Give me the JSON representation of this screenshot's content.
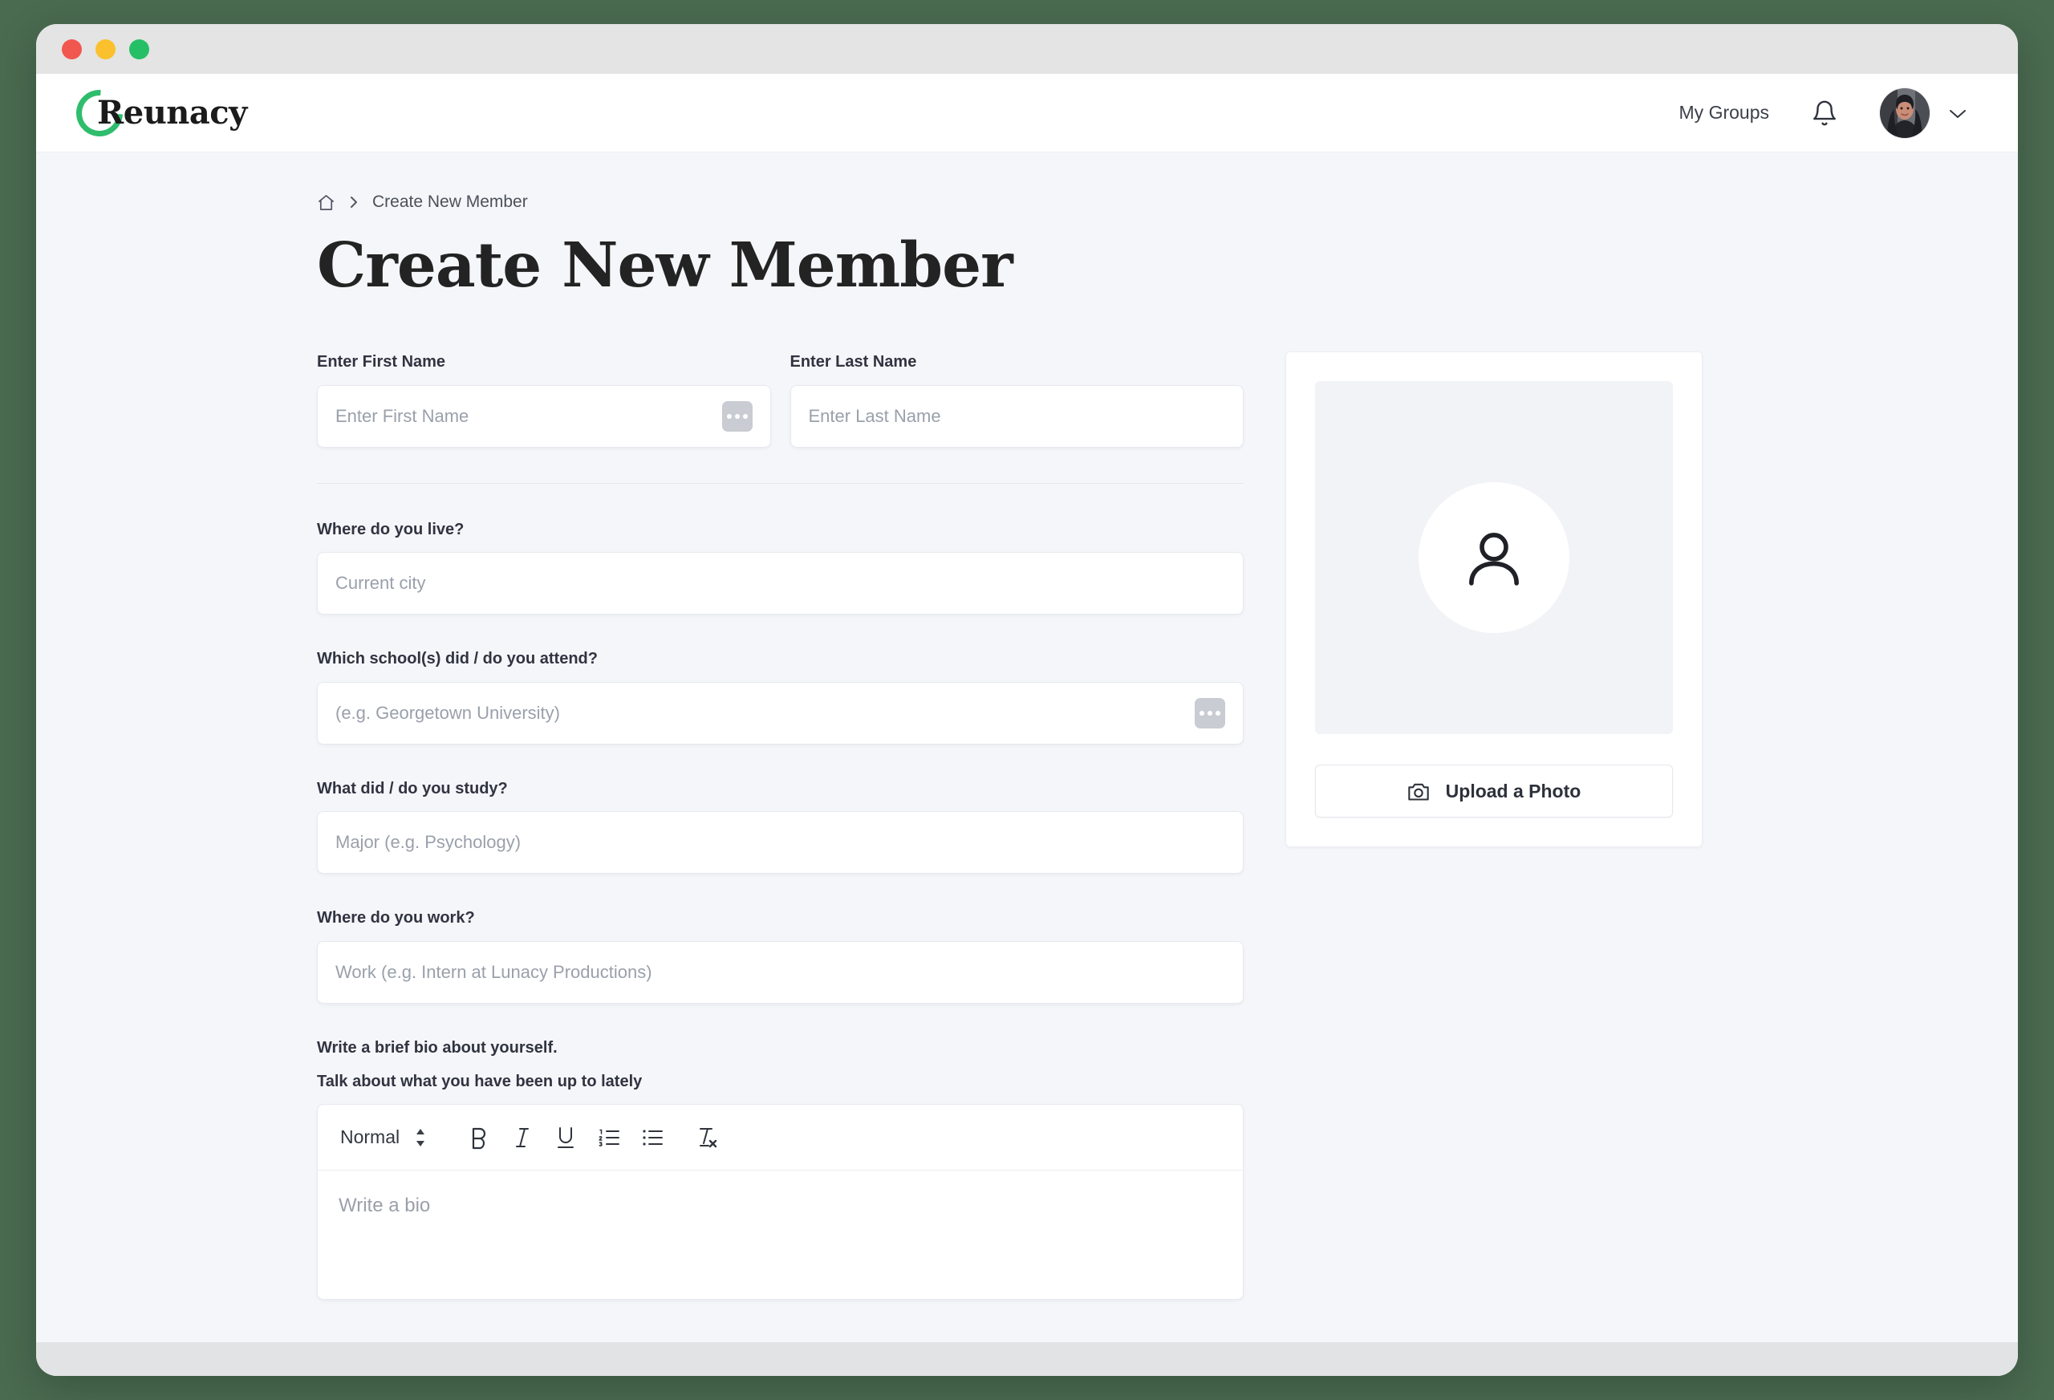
{
  "window": {
    "traffic_lights": [
      "close",
      "minimize",
      "maximize"
    ],
    "colors": {
      "desktop_background": "#4a6b50",
      "titlebar": "#e4e4e4",
      "page_background": "#f5f6fa",
      "brand_green": "#2fbd6d",
      "dot_red": "#f1574f",
      "dot_yellow": "#fbc02d",
      "dot_green": "#25c065"
    }
  },
  "header": {
    "logo_text": "Reunacy",
    "logo_icon": "green-ring-icon",
    "nav_link": "My Groups",
    "bell_icon": "bell-icon",
    "avatar_icon": "user-avatar-photo",
    "chevron_icon": "chevron-down-icon"
  },
  "breadcrumb": {
    "home_icon": "home-icon",
    "separator_icon": "chevron-right-icon",
    "current": "Create New Member"
  },
  "page": {
    "title": "Create New Member"
  },
  "form": {
    "first_name": {
      "label": "Enter First Name",
      "placeholder": "Enter First Name",
      "value": "",
      "chip_icon": "ellipsis-icon"
    },
    "last_name": {
      "label": "Enter Last Name",
      "placeholder": "Enter Last Name",
      "value": ""
    },
    "city": {
      "label": "Where do you live?",
      "placeholder": "Current city",
      "value": ""
    },
    "school": {
      "label": "Which school(s) did / do you attend?",
      "placeholder": "(e.g. Georgetown University)",
      "value": "",
      "chip_icon": "ellipsis-icon"
    },
    "study": {
      "label": "What did / do you study?",
      "placeholder": "Major (e.g. Psychology)",
      "value": ""
    },
    "work": {
      "label": "Where do you work?",
      "placeholder": "Work (e.g. Intern at Lunacy Productions)",
      "value": ""
    },
    "bio": {
      "label_line1": "Write a brief bio about yourself.",
      "label_line2": "Talk about what you have been up to lately",
      "placeholder": "Write a bio",
      "value": "",
      "toolbar": {
        "format_select": "Normal",
        "stepper_icon": "up-down-arrows-icon",
        "buttons": [
          {
            "name": "bold",
            "glyph": "B"
          },
          {
            "name": "italic",
            "glyph": "I"
          },
          {
            "name": "underline",
            "glyph": "U"
          },
          {
            "name": "ordered-list",
            "glyph": "1."
          },
          {
            "name": "bullet-list",
            "glyph": "•"
          },
          {
            "name": "clear-formatting",
            "glyph": "Tx"
          }
        ]
      }
    }
  },
  "photo_card": {
    "placeholder_icon": "person-icon",
    "upload_button": {
      "label": "Upload a Photo",
      "icon": "camera-icon"
    }
  }
}
